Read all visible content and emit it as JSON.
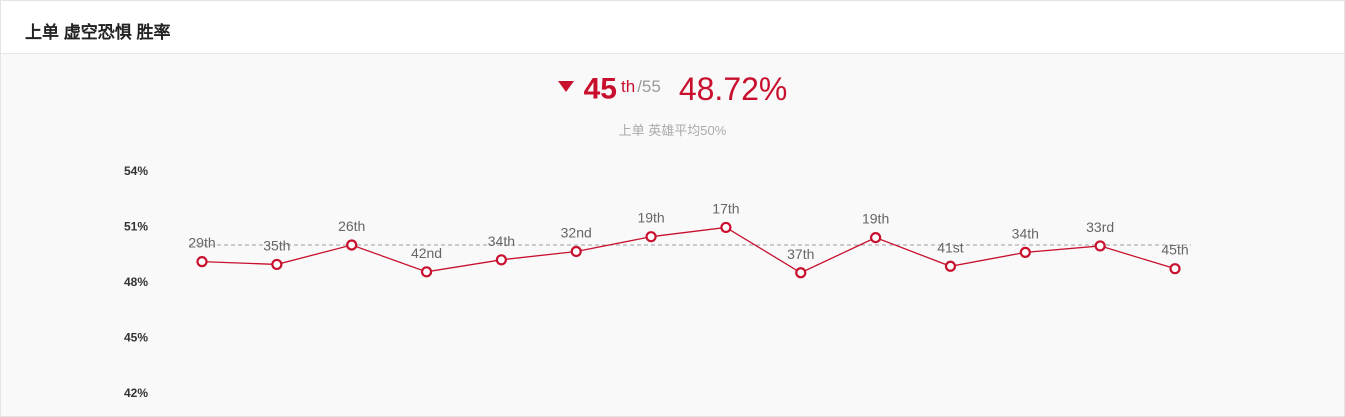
{
  "header": {
    "title": "上单 虚空恐惧 胜率"
  },
  "summary": {
    "rank": "45",
    "suffix": "th",
    "total": "/55",
    "win_rate": "48.72%",
    "trend": "down"
  },
  "subtitle": "上单 英雄平均50%",
  "colors": {
    "accent": "#c8102e",
    "reference_line": "#9e9e9e",
    "point_fill": "#ffffff"
  },
  "chart_data": {
    "type": "line",
    "yticks": [
      "54%",
      "51%",
      "48%",
      "45%",
      "42%"
    ],
    "ylim": [
      42,
      54
    ],
    "reference_value": 50,
    "x": [
      "1",
      "2",
      "3",
      "4",
      "5",
      "6",
      "7",
      "8",
      "9",
      "10",
      "11",
      "12",
      "13",
      "14"
    ],
    "series": [
      {
        "values": [
          49.1,
          48.95,
          50.0,
          48.55,
          49.2,
          49.65,
          50.45,
          50.95,
          48.5,
          50.4,
          48.85,
          49.6,
          49.95,
          48.72
        ],
        "labels": [
          "29th",
          "35th",
          "26th",
          "42nd",
          "34th",
          "32nd",
          "19th",
          "17th",
          "37th",
          "19th",
          "41st",
          "34th",
          "33rd",
          "45th"
        ]
      }
    ]
  }
}
